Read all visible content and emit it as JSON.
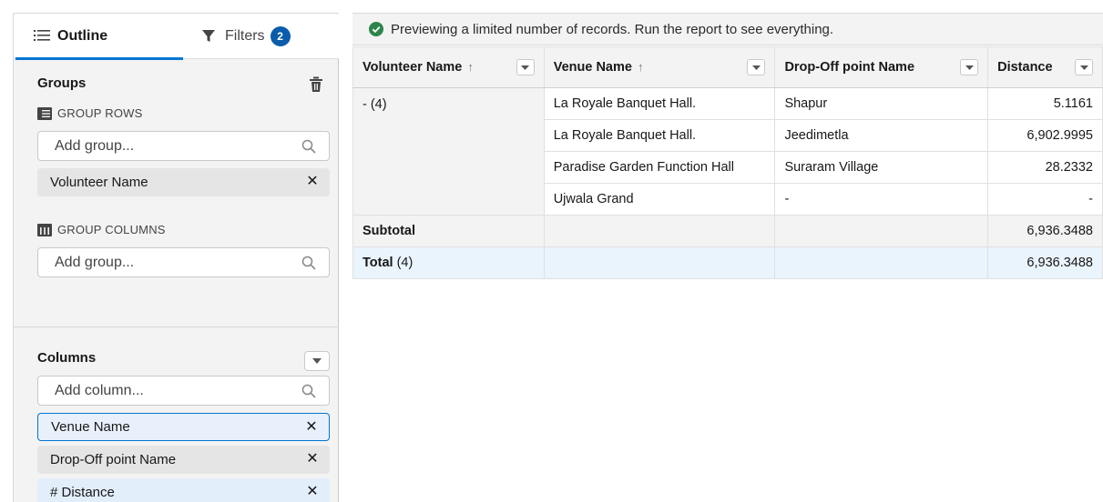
{
  "tabs": {
    "outline": "Outline",
    "filters": "Filters",
    "filters_count": "2"
  },
  "groups": {
    "title": "Groups",
    "rows_label": "GROUP ROWS",
    "rows_placeholder": "Add group...",
    "rows_items": [
      "Volunteer Name"
    ],
    "columns_label": "GROUP COLUMNS",
    "columns_placeholder": "Add group..."
  },
  "columns": {
    "title": "Columns",
    "placeholder": "Add column...",
    "items": [
      "Venue Name",
      "Drop-Off point Name",
      "# Distance"
    ]
  },
  "banner": {
    "text": "Previewing a limited number of records. Run the report to see everything."
  },
  "table": {
    "headers": [
      "Volunteer Name",
      "Venue Name",
      "Drop-Off point Name",
      "Distance"
    ],
    "group_label": "- (4)",
    "rows": [
      {
        "venue": "La Royale Banquet Hall.",
        "dropoff": "Shapur",
        "distance": "5.1161"
      },
      {
        "venue": "La Royale Banquet Hall.",
        "dropoff": "Jeedimetla",
        "distance": "6,902.9995"
      },
      {
        "venue": "Paradise Garden Function Hall",
        "dropoff": "Suraram Village",
        "distance": "28.2332"
      },
      {
        "venue": "Ujwala Grand",
        "dropoff": "-",
        "distance": "-"
      }
    ],
    "subtotal_label": "Subtotal",
    "subtotal_value": "6,936.3488",
    "total_label": "Total",
    "total_count": "(4)",
    "total_value": "6,936.3488"
  },
  "colors": {
    "accent": "#0176d3",
    "badge": "#0b5cab",
    "success": "#2e844a"
  }
}
